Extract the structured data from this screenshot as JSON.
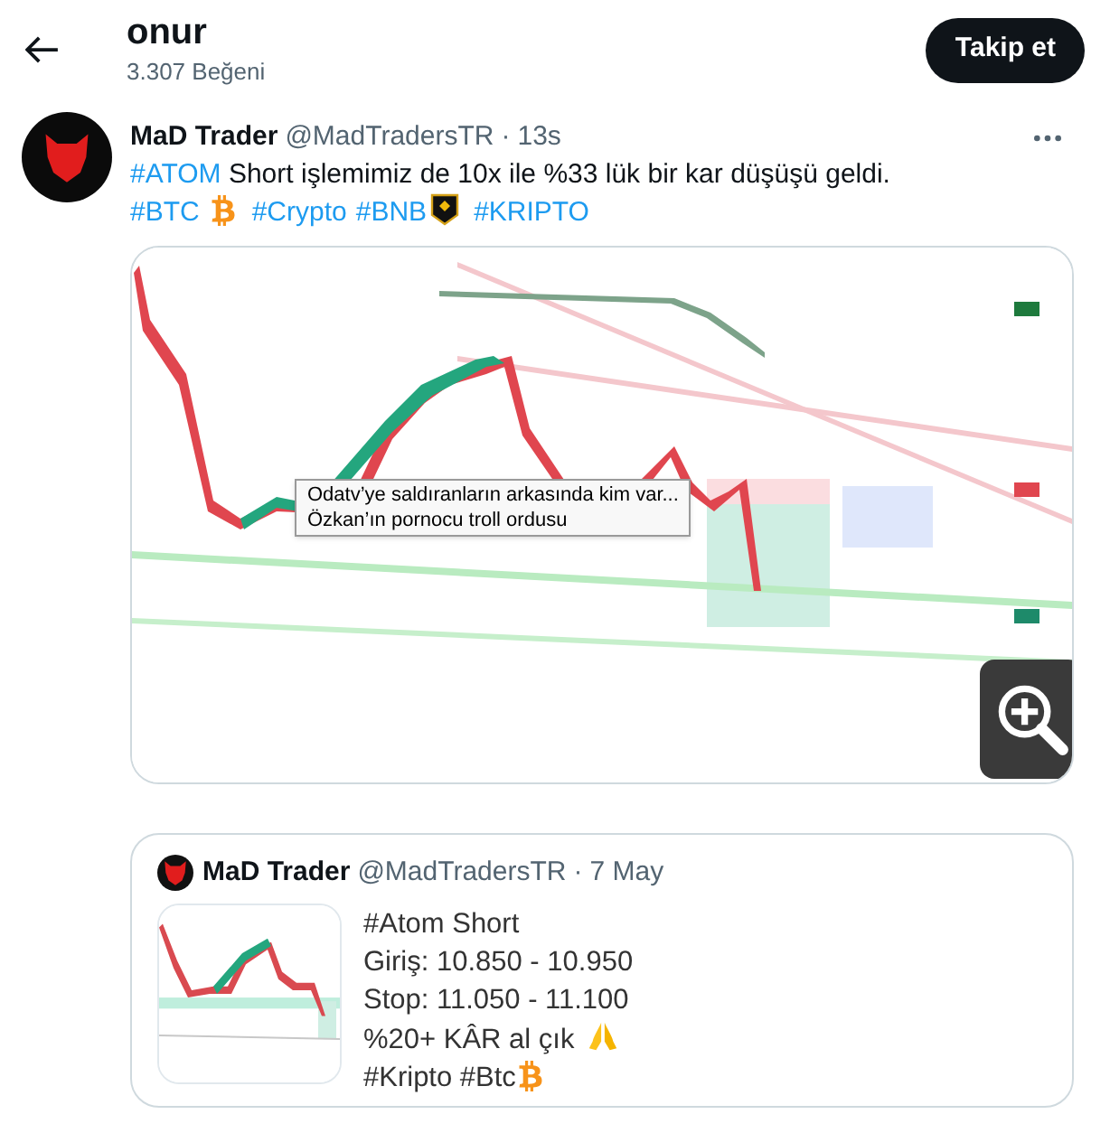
{
  "header": {
    "title": "onur",
    "subtitle": "3.307 Beğeni",
    "follow_button": "Takip et"
  },
  "tweet": {
    "name": "MaD Trader",
    "handle": "@MadTradersTR",
    "separator": "·",
    "time": "13s",
    "lines": [
      [
        {
          "kind": "hashtag",
          "text": "#ATOM"
        },
        {
          "kind": "text",
          "text": " Short işlemimiz de 10x ile %33 lük bir kar düşüşü geldi."
        }
      ],
      [
        {
          "kind": "hashtag",
          "text": "#BTC"
        },
        {
          "kind": "coin"
        },
        {
          "kind": "hashtag",
          "text": "#Crypto"
        },
        {
          "kind": "hashtag",
          "text": "#BNB"
        },
        {
          "kind": "badge"
        },
        {
          "kind": "hashtag",
          "text": "#KRIPTO"
        }
      ]
    ],
    "media": {
      "kind": "picture",
      "tooltip": [
        "Odatv’ye saldıranların arkasında kim var...",
        "Özkan’ın pornocu troll ordusu"
      ]
    }
  },
  "quote": {
    "name": "MaD Trader",
    "handle": "@MadTradersTR",
    "separator": "·",
    "time": "7 May",
    "lines": [
      [
        {
          "kind": "text",
          "text": "#Atom Short"
        }
      ],
      [
        {
          "kind": "text",
          "text": "Giriş: 10.850 - 10.950"
        }
      ],
      [
        {
          "kind": "text",
          "text": "Stop: 11.050 - 11.100"
        }
      ],
      [
        {
          "kind": "text",
          "text": "%20+ KÂR al çık"
        },
        {
          "kind": "hands"
        }
      ],
      [
        {
          "kind": "text",
          "text": "#Kripto #Btc"
        },
        {
          "kind": "coin"
        }
      ]
    ]
  }
}
